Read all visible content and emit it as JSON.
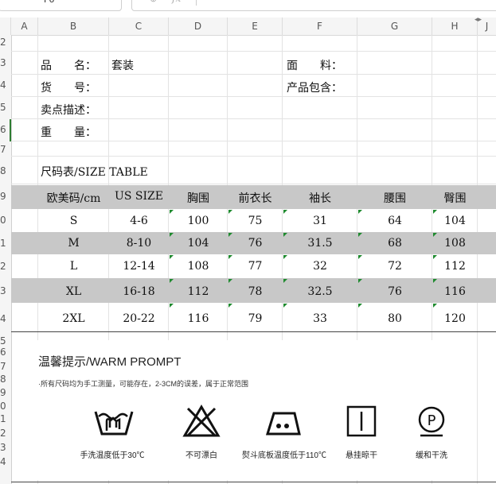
{
  "toolbar": {
    "cell_ref": "F6",
    "fx_label": "fx"
  },
  "columns": [
    "A",
    "B",
    "C",
    "D",
    "E",
    "F",
    "G",
    "H",
    "J"
  ],
  "rows": [
    "2",
    "3",
    "4",
    "5",
    "6",
    "7",
    "8",
    "9",
    "0",
    "1",
    "2",
    "3",
    "4",
    "5",
    "6",
    "7",
    "8",
    "9",
    "0",
    "1",
    "2",
    "3",
    "4"
  ],
  "info": {
    "name_label": "品　　名：",
    "name_value": "套装",
    "material_label": "面　　料：",
    "code_label": "货　　号：",
    "package_label": "产品包含：",
    "selling_label": "卖点描述：",
    "weight_label": "重　　量："
  },
  "size_table": {
    "title": "尺码表/SIZE TABLE",
    "headers": [
      "欧美码/cm",
      "US SIZE",
      "胸围",
      "前衣长",
      "袖长",
      "腰围",
      "臀围"
    ],
    "rows": [
      [
        "S",
        "4-6",
        "100",
        "75",
        "31",
        "64",
        "104"
      ],
      [
        "M",
        "8-10",
        "104",
        "76",
        "31.5",
        "68",
        "108"
      ],
      [
        "L",
        "12-14",
        "108",
        "77",
        "32",
        "72",
        "112"
      ],
      [
        "XL",
        "16-18",
        "112",
        "78",
        "32.5",
        "76",
        "116"
      ],
      [
        "2XL",
        "20-22",
        "116",
        "79",
        "33",
        "80",
        "120"
      ]
    ]
  },
  "prompt": {
    "title": "温馨提示/WARM PROMPT",
    "note": "·所有尺码均为手工测量，可能存在，2-3CM的误差，属于正常范围",
    "care": [
      {
        "icon": "hand-wash-icon",
        "label": "手洗温度低于30℃"
      },
      {
        "icon": "no-bleach-icon",
        "label": "不可漂白"
      },
      {
        "icon": "iron-medium-icon",
        "label": "熨斗底板温度低于110℃"
      },
      {
        "icon": "hang-dry-icon",
        "label": "悬挂晾干"
      },
      {
        "icon": "dry-clean-p-icon",
        "label": "缓和干洗"
      }
    ]
  }
}
